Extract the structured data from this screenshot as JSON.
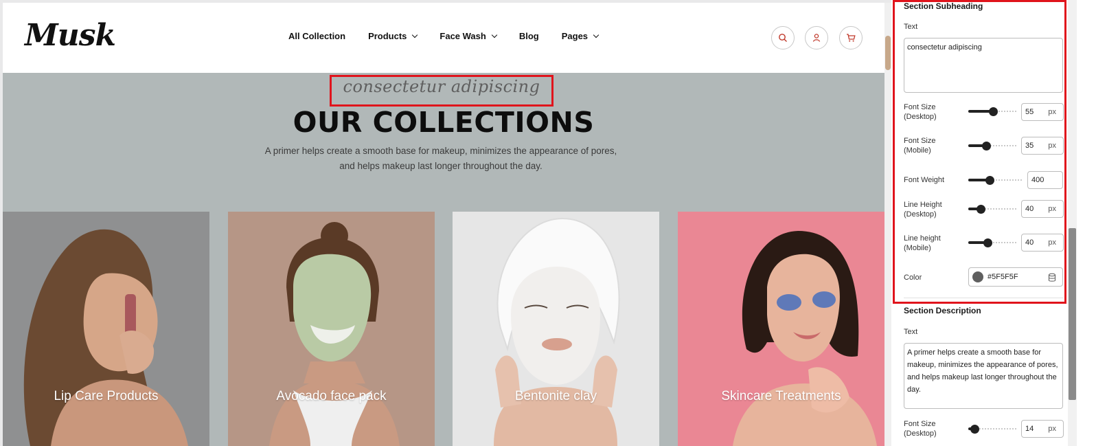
{
  "site": {
    "logo": "Musk",
    "nav": [
      {
        "label": "All Collection",
        "dropdown": false
      },
      {
        "label": "Products",
        "dropdown": true
      },
      {
        "label": "Face Wash",
        "dropdown": true
      },
      {
        "label": "Blog",
        "dropdown": false
      },
      {
        "label": "Pages",
        "dropdown": true
      }
    ],
    "header_icons": [
      "search-icon",
      "user-icon",
      "cart-icon"
    ],
    "accent_color": "#c0392b"
  },
  "section": {
    "subheading": "consectetur adipiscing",
    "title": "OUR COLLECTIONS",
    "description": "A primer helps create a smooth base for makeup, minimizes the appearance of pores, and helps makeup last longer throughout the day."
  },
  "cards": [
    {
      "label": "Lip Care Products",
      "bg": "#8f9091"
    },
    {
      "label": "Avocado face pack",
      "bg": "#b69686"
    },
    {
      "label": "Bentonite clay",
      "bg": "#e6e6e6"
    },
    {
      "label": "Skincare Treatments",
      "bg": "#ea8794"
    }
  ],
  "panel": {
    "subheading_section": {
      "heading": "Section Subheading",
      "text_label": "Text",
      "text_value": "consectetur adipiscing",
      "font_size_desktop_label": "Font Size\n(Desktop)",
      "font_size_desktop": "55",
      "font_size_mobile_label": "Font Size\n(Mobile)",
      "font_size_mobile": "35",
      "font_weight_label": "Font Weight",
      "font_weight": "400",
      "line_height_desktop_label": "Line Height\n(Desktop)",
      "line_height_desktop": "40",
      "line_height_mobile_label": "Line height\n(Mobile)",
      "line_height_mobile": "40",
      "color_label": "Color",
      "color_value": "#5F5F5F",
      "unit": "px"
    },
    "description_section": {
      "heading": "Section Description",
      "text_label": "Text",
      "text_value": "A primer helps create a smooth base for makeup, minimizes the appearance of pores, and helps makeup last longer throughout the day.",
      "font_size_desktop_label": "Font Size\n(Desktop)",
      "font_size_desktop": "14",
      "unit": "px"
    },
    "slider_levels": {
      "font_size_desktop": 0.52,
      "font_size_mobile": 0.37,
      "font_weight": 0.4,
      "line_height_desktop": 0.25,
      "line_height_mobile": 0.4,
      "desc_font_size_desktop": 0.13
    }
  }
}
